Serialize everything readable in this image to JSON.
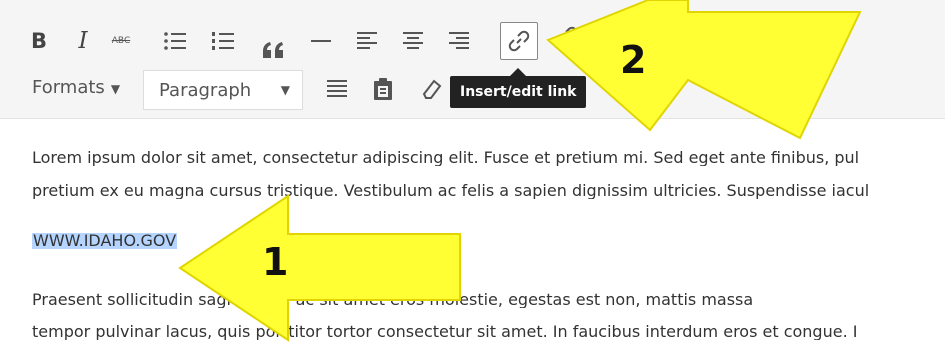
{
  "toolbar": {
    "row1": [
      {
        "name": "bold-button",
        "label": "B"
      },
      {
        "name": "italic-button",
        "label": "I"
      },
      {
        "name": "strikethrough-button",
        "label": "ABC"
      },
      {
        "name": "bulleted-list-button",
        "icon": "bullet-list-icon"
      },
      {
        "name": "numbered-list-button",
        "icon": "numbered-list-icon"
      },
      {
        "name": "blockquote-button",
        "label": "66"
      },
      {
        "name": "horizontal-line-button",
        "icon": "horizontal-line-icon"
      },
      {
        "name": "align-left-button",
        "icon": "align-left-icon"
      },
      {
        "name": "align-center-button",
        "icon": "align-center-icon"
      },
      {
        "name": "align-right-button",
        "icon": "align-right-icon"
      },
      {
        "name": "insert-link-button",
        "icon": "link-icon",
        "active": true
      },
      {
        "name": "unlink-button",
        "icon": "unlink-icon"
      }
    ],
    "formats_label": "Formats",
    "paragraph_select": "Paragraph",
    "tooltip": "Insert/edit link"
  },
  "content": {
    "p1": "Lorem ipsum dolor sit amet, consectetur adipiscing elit. Fusce et pretium mi. Sed eget ante finibus, pul",
    "p2": "pretium ex eu magna cursus tristique. Vestibulum ac felis a sapien dignissim ultricies. Suspendisse iacul",
    "selected_link": "WWW.IDAHO.GOV",
    "p4": "Praesent sollicitudin sagittis leo, ac sit amet eros molestie, egestas est non, mattis massa",
    "p5": "tempor pulvinar lacus, quis porttitor tortor consectetur sit amet. In faucibus interdum eros et congue. I"
  },
  "annotations": {
    "step1": "1",
    "step2": "2",
    "arrow_color": "#ffff33"
  }
}
